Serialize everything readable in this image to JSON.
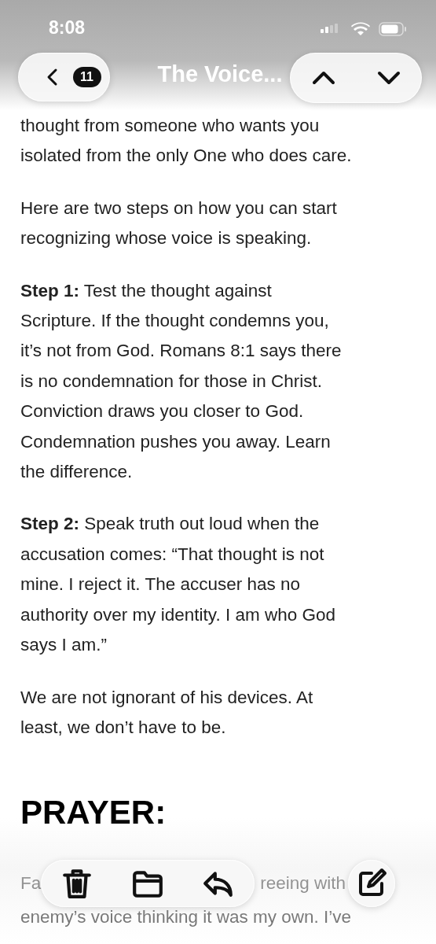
{
  "status_bar": {
    "time": "8:08"
  },
  "nav": {
    "title": "The Voice...",
    "unread_count": "11"
  },
  "article": [
    {
      "kind": "paragraph",
      "lines": [
        "thought from someone who wants you",
        "isolated from the only One who does care."
      ]
    },
    {
      "kind": "paragraph",
      "lines": [
        "Here are two steps on how you can start",
        "recognizing whose voice is speaking."
      ]
    },
    {
      "kind": "paragraph",
      "lines": [
        "**Step 1:** Test the thought against",
        "Scripture. If the thought condemns you,",
        "it’s not from God. Romans 8:1 says there",
        "is no condemnation for those in Christ.",
        "Conviction draws you closer to God.",
        "Condemnation pushes you away. Learn",
        "the difference."
      ]
    },
    {
      "kind": "paragraph",
      "lines": [
        "**Step 2:** Speak truth out loud when the",
        "accusation comes: “That thought is not",
        "mine. I reject it. The accuser has no",
        "authority over my identity. I am who God",
        "says I am.”"
      ]
    },
    {
      "kind": "paragraph",
      "lines": [
        "We are not ignorant of his devices. At",
        "least, we don’t have to be."
      ]
    },
    {
      "kind": "heading",
      "lines": [
        "PRAYER:"
      ]
    },
    {
      "kind": "covered",
      "first_parts": [
        "Fa",
        "reeing with"
      ],
      "lines": [
        "enemy’s voice thinking it was my own. I’ve"
      ]
    }
  ]
}
